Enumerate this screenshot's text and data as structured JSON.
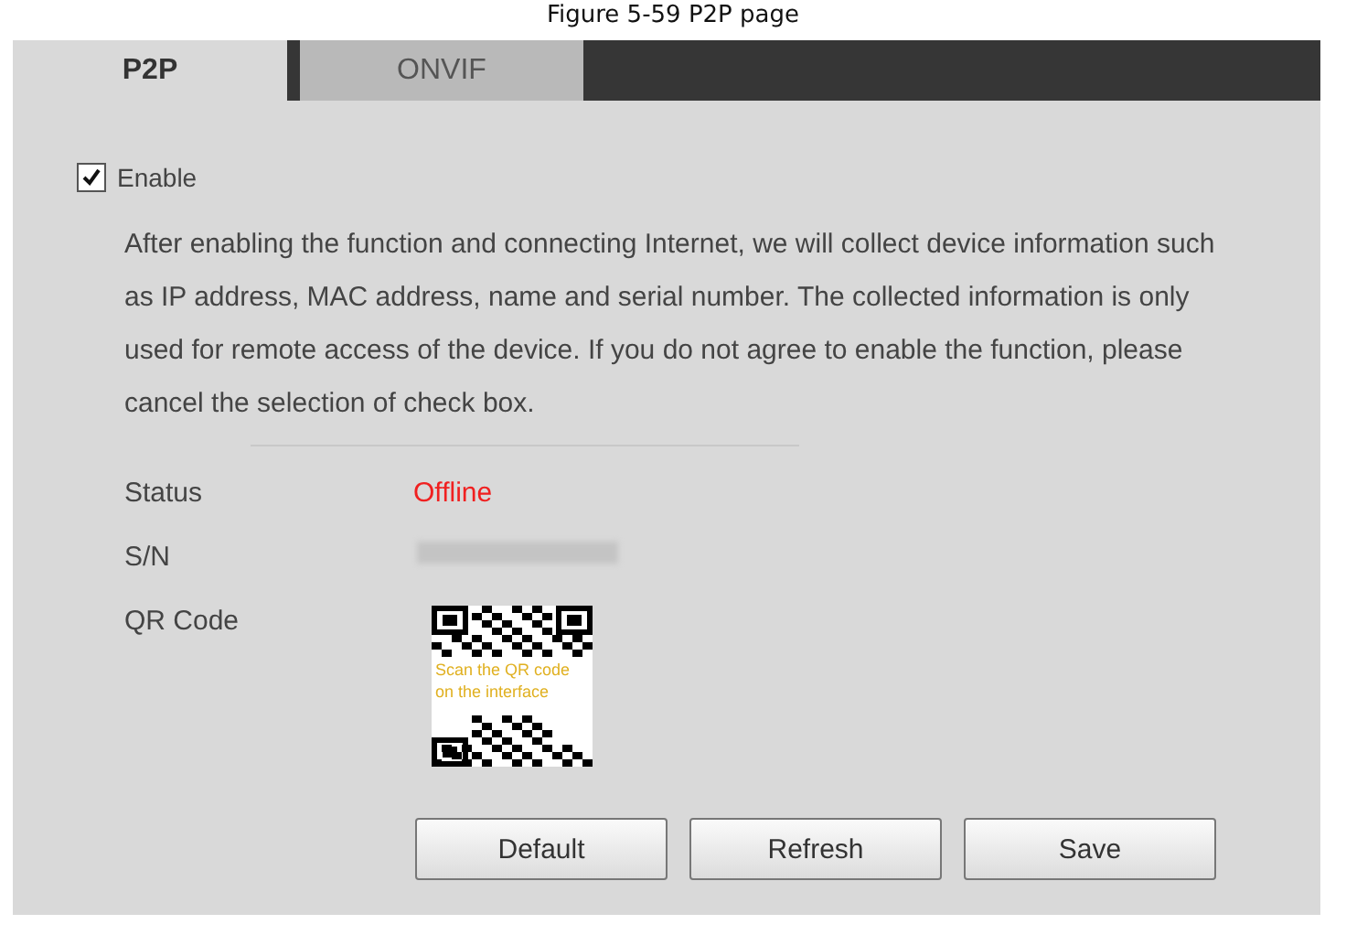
{
  "caption": "Figure 5-59 P2P page",
  "tabs": [
    {
      "label": "P2P",
      "selected": true
    },
    {
      "label": "ONVIF",
      "selected": false
    }
  ],
  "enable": {
    "label": "Enable",
    "checked": true
  },
  "notice": "After enabling the function and connecting Internet, we will collect device information such as IP address, MAC address, name and serial number. The collected information is only used for remote access of the device. If you do not agree to enable the function, please cancel the selection of check box.",
  "fields": [
    {
      "label": "Status",
      "kind": "status",
      "value": "Offline"
    },
    {
      "label": "S/N",
      "kind": "hidden"
    },
    {
      "label": "QR Code",
      "kind": "qr",
      "value": "Scan the QR code on the interface"
    }
  ],
  "buttons": [
    "Default",
    "Refresh",
    "Save"
  ]
}
